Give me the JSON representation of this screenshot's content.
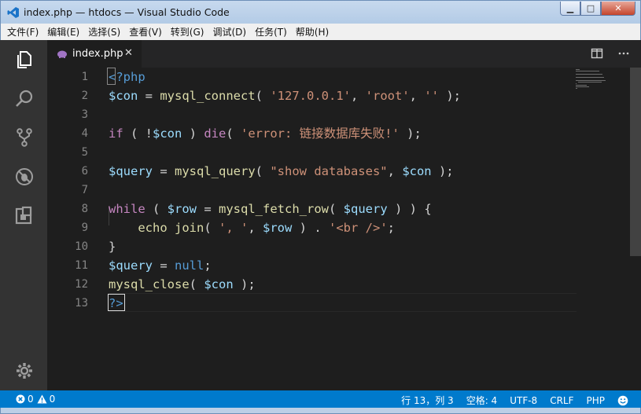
{
  "window": {
    "title": "index.php — htdocs — Visual Studio Code",
    "buttons": {
      "minimize": "▁",
      "maximize": "□",
      "close": "✕"
    }
  },
  "menu": [
    "文件(F)",
    "编辑(E)",
    "选择(S)",
    "查看(V)",
    "转到(G)",
    "调试(D)",
    "任务(T)",
    "帮助(H)"
  ],
  "activity_icons": [
    "files-icon",
    "search-icon",
    "source-control-icon",
    "debug-icon",
    "extensions-icon",
    "gear-icon"
  ],
  "tab": {
    "label": "index.php",
    "close": "✕"
  },
  "editor": {
    "line_numbers": [
      "1",
      "2",
      "3",
      "4",
      "5",
      "6",
      "7",
      "8",
      "9",
      "10",
      "11",
      "12",
      "13"
    ]
  },
  "status": {
    "errors": "0",
    "warnings": "0",
    "position": "行 13，列 3",
    "indent": "空格: 4",
    "encoding": "UTF-8",
    "eol": "CRLF",
    "language": "PHP"
  },
  "colors": {
    "keyword": "#569cd6",
    "control": "#c586c0",
    "function": "#dcdcaa",
    "variable": "#9cdcfe",
    "string": "#ce9178",
    "statusbar": "#007acc"
  }
}
